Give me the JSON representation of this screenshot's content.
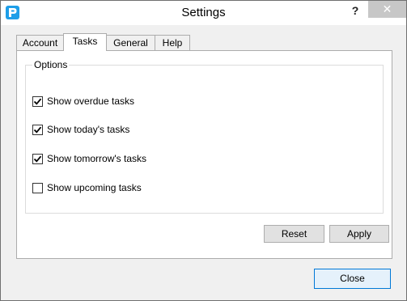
{
  "window": {
    "title": "Settings",
    "help_label": "?",
    "close_label": "✕"
  },
  "tabs": [
    {
      "label": "Account",
      "active": false
    },
    {
      "label": "Tasks",
      "active": true
    },
    {
      "label": "General",
      "active": false
    },
    {
      "label": "Help",
      "active": false
    }
  ],
  "options": {
    "group_title": "Options",
    "items": [
      {
        "label": "Show overdue tasks",
        "checked": true
      },
      {
        "label": "Show today's tasks",
        "checked": true
      },
      {
        "label": "Show tomorrow's tasks",
        "checked": true
      },
      {
        "label": "Show upcoming tasks",
        "checked": false
      }
    ]
  },
  "buttons": {
    "reset_label": "Reset",
    "apply_label": "Apply",
    "close_label": "Close"
  },
  "colors": {
    "accent": "#0078d7",
    "app_icon": "#1e9ee8"
  }
}
